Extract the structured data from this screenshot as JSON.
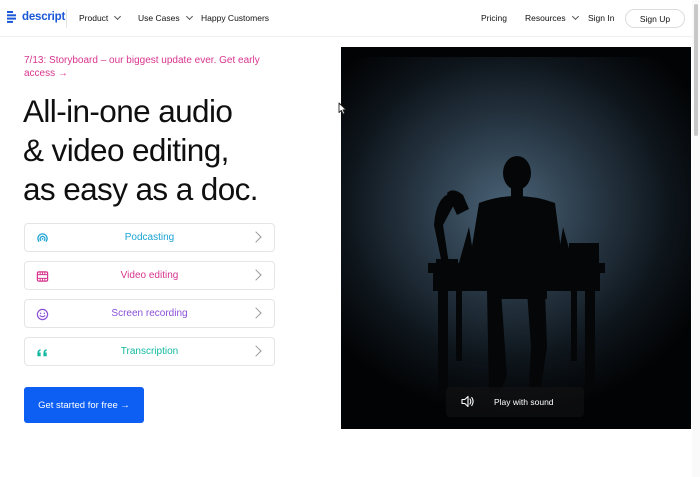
{
  "nav": {
    "logo_text": "descript",
    "product": "Product",
    "use_cases": "Use Cases",
    "happy_customers": "Happy Customers",
    "pricing": "Pricing",
    "resources": "Resources",
    "sign_in": "Sign In",
    "sign_up": "Sign Up"
  },
  "hero": {
    "announcement": "7/13: Storyboard – our biggest update ever. Get early access →",
    "headline_1": "All-in-one audio",
    "headline_2": "& video editing,",
    "headline_3": "as easy as a doc.",
    "features": [
      {
        "label": "Podcasting",
        "icon": "podcast-icon",
        "color": "#1aa3d4"
      },
      {
        "label": "Video editing",
        "icon": "film-icon",
        "color": "#d9358f"
      },
      {
        "label": "Screen recording",
        "icon": "smiley-icon",
        "color": "#8a4fd8"
      },
      {
        "label": "Transcription",
        "icon": "quote-icon",
        "color": "#13b8a0"
      }
    ],
    "cta": "Get started for free →"
  },
  "video": {
    "play_label": "Play with sound"
  },
  "colors": {
    "brand_blue": "#1a57d6",
    "cta_blue": "#0c5ff2",
    "announce_pink": "#d9358f"
  }
}
